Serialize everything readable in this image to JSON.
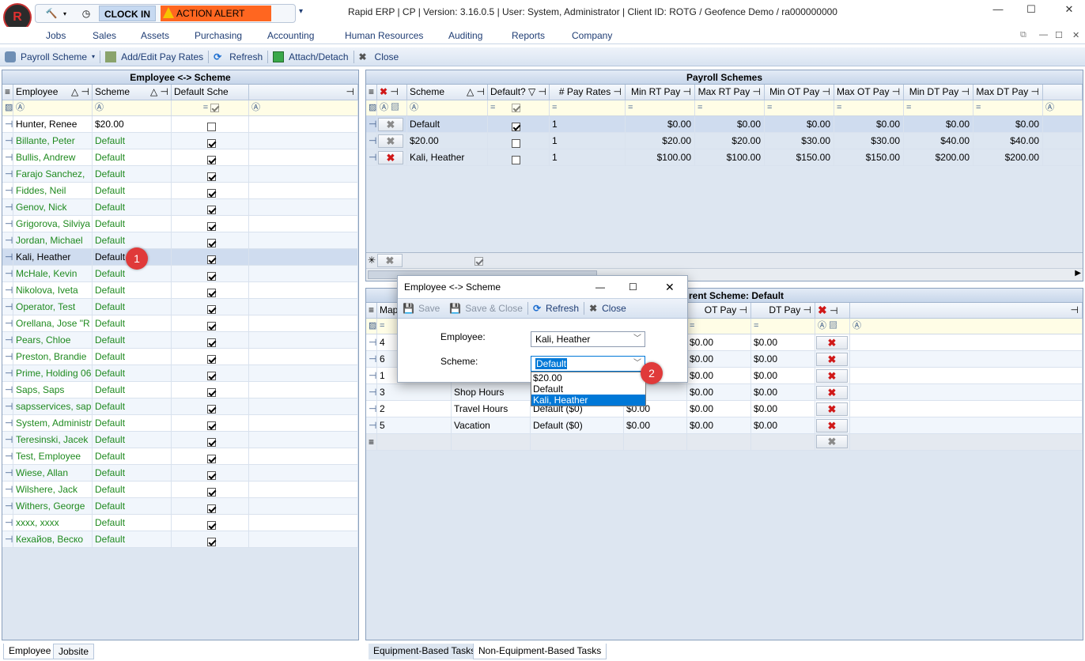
{
  "app": {
    "title": "Rapid ERP | CP | Version: 3.16.0.5 | User: System, Administrator | Client ID: ROTG / Geofence Demo / ra000000000",
    "clock_in": "CLOCK IN",
    "action_alert": "ACTION ALERT",
    "win_minimize": "—",
    "win_maximize": "☐",
    "win_close": "✕"
  },
  "menu": [
    "Jobs",
    "Sales",
    "Assets",
    "Purchasing",
    "Accounting",
    "Human Resources",
    "Auditing",
    "Reports",
    "Company"
  ],
  "toolbar": {
    "payroll_scheme": "Payroll Scheme",
    "add_edit": "Add/Edit Pay Rates",
    "refresh": "Refresh",
    "attach": "Attach/Detach",
    "close": "Close"
  },
  "left_panel": {
    "title": "Employee <-> Scheme",
    "columns": [
      "Employee",
      "Scheme",
      "Default Sche"
    ],
    "rows": [
      {
        "employee": "Hunter, Renee",
        "scheme": "$20.00",
        "default": false,
        "green": false
      },
      {
        "employee": "Billante, Peter",
        "scheme": "Default",
        "default": true,
        "green": true
      },
      {
        "employee": "Bullis, Andrew",
        "scheme": "Default",
        "default": true,
        "green": true
      },
      {
        "employee": "Farajo Sanchez,",
        "scheme": "Default",
        "default": true,
        "green": true
      },
      {
        "employee": "Fiddes, Neil",
        "scheme": "Default",
        "default": true,
        "green": true
      },
      {
        "employee": "Genov, Nick",
        "scheme": "Default",
        "default": true,
        "green": true
      },
      {
        "employee": "Grigorova, Silviya",
        "scheme": "Default",
        "default": true,
        "green": true
      },
      {
        "employee": "Jordan, Michael",
        "scheme": "Default",
        "default": true,
        "green": true
      },
      {
        "employee": "Kali, Heather",
        "scheme": "Default",
        "default": true,
        "green": false,
        "selected": true
      },
      {
        "employee": "McHale, Kevin",
        "scheme": "Default",
        "default": true,
        "green": true
      },
      {
        "employee": "Nikolova, Iveta",
        "scheme": "Default",
        "default": true,
        "green": true
      },
      {
        "employee": "Operator, Test",
        "scheme": "Default",
        "default": true,
        "green": true
      },
      {
        "employee": "Orellana, Jose \"R",
        "scheme": "Default",
        "default": true,
        "green": true
      },
      {
        "employee": "Pears, Chloe",
        "scheme": "Default",
        "default": true,
        "green": true
      },
      {
        "employee": "Preston, Brandie",
        "scheme": "Default",
        "default": true,
        "green": true
      },
      {
        "employee": "Prime, Holding 06",
        "scheme": "Default",
        "default": true,
        "green": true
      },
      {
        "employee": "Saps, Saps",
        "scheme": "Default",
        "default": true,
        "green": true
      },
      {
        "employee": "sapsservices, sap",
        "scheme": "Default",
        "default": true,
        "green": true
      },
      {
        "employee": "System, Administr",
        "scheme": "Default",
        "default": true,
        "green": true
      },
      {
        "employee": "Teresinski, Jacek",
        "scheme": "Default",
        "default": true,
        "green": true
      },
      {
        "employee": "Test, Employee",
        "scheme": "Default",
        "default": true,
        "green": true
      },
      {
        "employee": "Wiese, Allan",
        "scheme": "Default",
        "default": true,
        "green": true
      },
      {
        "employee": "Wilshere, Jack",
        "scheme": "Default",
        "default": true,
        "green": true
      },
      {
        "employee": "Withers, George",
        "scheme": "Default",
        "default": true,
        "green": true
      },
      {
        "employee": "xxxx, xxxx",
        "scheme": "Default",
        "default": true,
        "green": true
      },
      {
        "employee": "Кехайов, Веско",
        "scheme": "Default",
        "default": true,
        "green": true
      }
    ],
    "tabs": [
      "Employee",
      "Jobsite"
    ]
  },
  "schemes_panel": {
    "title": "Payroll Schemes",
    "columns": [
      "Scheme",
      "Default?",
      "# Pay Rates",
      "Min RT Pay",
      "Max RT Pay",
      "Min OT Pay",
      "Max OT Pay",
      "Min DT Pay",
      "Max DT Pay"
    ],
    "rows": [
      {
        "scheme": "Default",
        "default": true,
        "pay_rates": "1",
        "min_rt": "$0.00",
        "max_rt": "$0.00",
        "min_ot": "$0.00",
        "max_ot": "$0.00",
        "min_dt": "$0.00",
        "max_dt": "$0.00",
        "red": false
      },
      {
        "scheme": "$20.00",
        "default": false,
        "pay_rates": "1",
        "min_rt": "$20.00",
        "max_rt": "$20.00",
        "min_ot": "$30.00",
        "max_ot": "$30.00",
        "min_dt": "$40.00",
        "max_dt": "$40.00",
        "red": false
      },
      {
        "scheme": "Kali, Heather",
        "default": false,
        "pay_rates": "1",
        "min_rt": "$100.00",
        "max_rt": "$100.00",
        "min_ot": "$150.00",
        "max_ot": "$150.00",
        "min_dt": "$200.00",
        "max_dt": "$200.00",
        "red": true
      }
    ]
  },
  "rates_panel": {
    "title": "rent Scheme: Default",
    "columns": [
      "Mapp",
      "OT Pay",
      "DT Pay"
    ],
    "rows": [
      {
        "id": "4",
        "name": "",
        "rate": "",
        "rt": "",
        "ot": "$0.00",
        "dt": "$0.00"
      },
      {
        "id": "6",
        "name": "",
        "rate": "",
        "rt": "",
        "ot": "$0.00",
        "dt": "$0.00"
      },
      {
        "id": "1",
        "name": "",
        "rate": "",
        "rt": "",
        "ot": "$0.00",
        "dt": "$0.00"
      },
      {
        "id": "3",
        "name": "Shop Hours",
        "rate": "",
        "rt": "0",
        "ot": "$0.00",
        "dt": "$0.00"
      },
      {
        "id": "2",
        "name": "Travel Hours",
        "rate": "Default ($0)",
        "rt": "$0.00",
        "ot": "$0.00",
        "dt": "$0.00"
      },
      {
        "id": "5",
        "name": "Vacation",
        "rate": "Default ($0)",
        "rt": "$0.00",
        "ot": "$0.00",
        "dt": "$0.00"
      }
    ],
    "tabs": [
      "Equipment-Based Tasks",
      "Non-Equipment-Based Tasks"
    ]
  },
  "dialog": {
    "title": "Employee <-> Scheme",
    "save": "Save",
    "save_close": "Save & Close",
    "refresh": "Refresh",
    "close": "Close",
    "employee_label": "Employee:",
    "employee_value": "Kali, Heather",
    "scheme_label": "Scheme:",
    "scheme_value": "Default",
    "options": [
      "$20.00",
      "Default",
      "Kali, Heather"
    ],
    "highlighted_option": "Kali, Heather"
  },
  "badges": [
    "1",
    "2"
  ]
}
